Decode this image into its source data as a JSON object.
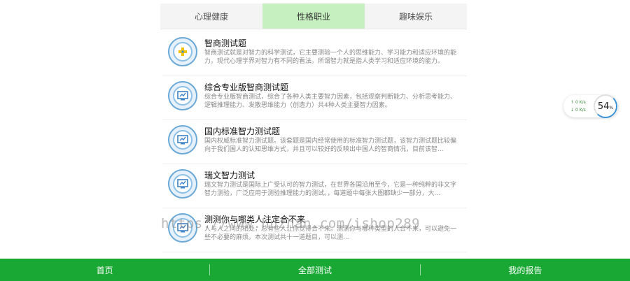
{
  "tabs": [
    {
      "label": "心理健康",
      "active": false
    },
    {
      "label": "性格职业",
      "active": true
    },
    {
      "label": "趣味娱乐",
      "active": false
    }
  ],
  "tests": [
    {
      "title": "智商测试题",
      "desc": "智商测试就是对智力的科学测试，它主要测验一个人的思维能力、学习能力和适应环境的能力。现代心理学界对智力有不同的看法。所谓智力就是指人类学习和适应环境的能力。"
    },
    {
      "title": "综合专业版智商测试题",
      "desc": "综合专业版智商测试，综合了各种人类主要智力因素，包括观察判断能力、分析思考能力、逻辑推理能力、发散思维能力（创造力）共4种人类主要智力因素。"
    },
    {
      "title": "国内标准智力测试题",
      "desc": "国内权威标准智力测试题。该套题是国内经常使用的标准智力测试题，该智力测试题比较偏向于我们国人的认知思维方式，并且可以较好的反映出中国人的智商情况，目前该智..."
    },
    {
      "title": "瑞文智力测试",
      "desc": "瑞文智力测试是国际上广受认可的智力测试，在世界各国沿用至今，它是一种纯粹的非文字智力测验，广泛应用于测验推理能力的测试。，每道题中每张大图都缺少一部分，大..."
    },
    {
      "title": "测测你与哪类人注定合不来",
      "desc": "人与人之间的相处，总有些人让你觉得合不来。测测你与哪种类型的人合不来，可以避免一些不必要的麻烦。本次测试共十一道题目，可以测..."
    }
  ],
  "watermark": "https://www.huzhan.com/ishop289",
  "speed": {
    "up": "0",
    "down": "0",
    "unit": "K/s",
    "percent": "54",
    "percent_sign": "%"
  },
  "footer": [
    {
      "label": "首页"
    },
    {
      "label": "全部测试"
    },
    {
      "label": "我的报告"
    }
  ],
  "colors": {
    "accent": "#19a834",
    "tab_active": "#c7f0c0",
    "logo_ring": "#6aa8d6"
  }
}
